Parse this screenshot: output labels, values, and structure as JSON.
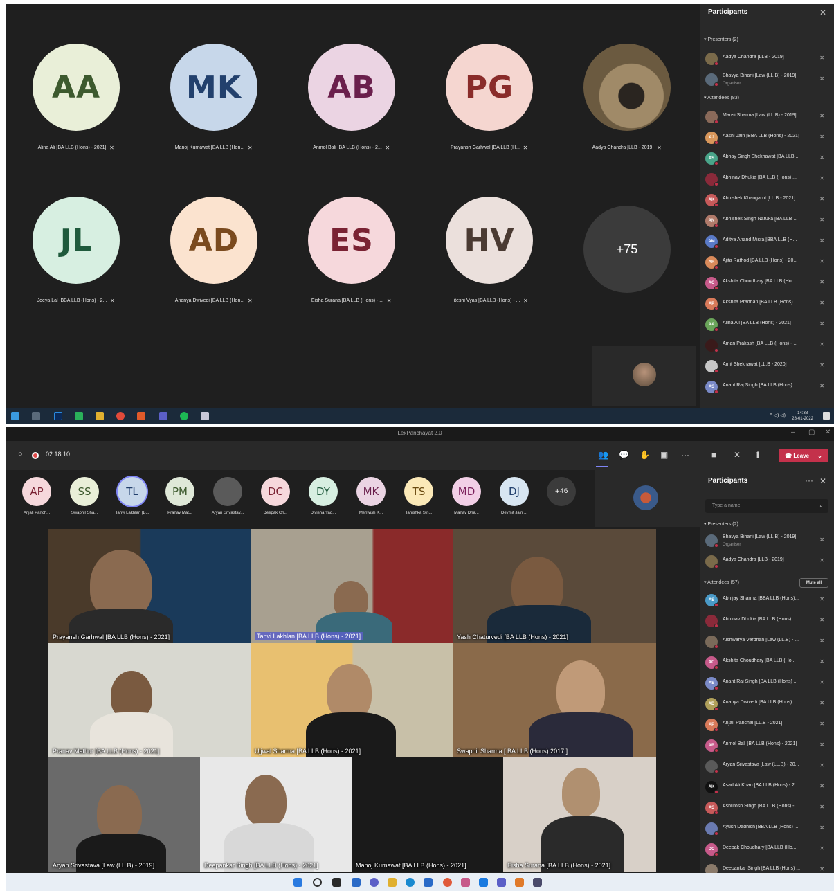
{
  "top": {
    "tiles_row1": [
      {
        "initials": "AA",
        "name": "Alina Ali [BA LLB (Hons) - 2021]",
        "bg": "#e9efd8",
        "fg": "#3d5a2e"
      },
      {
        "initials": "MK",
        "name": "Manoj Kumawat [BA LLB (Hon...",
        "bg": "#c7d7ea",
        "fg": "#22406d"
      },
      {
        "initials": "AB",
        "name": "Anmol Bali [BA LLB (Hons) - 2...",
        "bg": "#ebd4e3",
        "fg": "#6a1f4c"
      },
      {
        "initials": "PG",
        "name": "Prayansh Garhwal [BA LLB (H...",
        "bg": "#f5d6d0",
        "fg": "#8a2c2a"
      },
      {
        "initials": "",
        "name": "Aadya Chandra [LLB - 2019]",
        "bg": "#8a7a5a",
        "fg": "#fff"
      }
    ],
    "tiles_row2": [
      {
        "initials": "JL",
        "name": "Joeya Lal [BBA LLB (Hons) - 2...",
        "bg": "#d7efe1",
        "fg": "#1f5a3c"
      },
      {
        "initials": "AD",
        "name": "Ananya Dwivedi [BA LLB (Hon...",
        "bg": "#fbe3cf",
        "fg": "#7a4a1e"
      },
      {
        "initials": "ES",
        "name": "Eisha Surana [BA LLB (Hons) - ...",
        "bg": "#f6d8dc",
        "fg": "#7a2233"
      },
      {
        "initials": "HV",
        "name": "Hiteshi Vyas [BA LLB (Hons) - ...",
        "bg": "#ebe0dc",
        "fg": "#4a3a32"
      }
    ],
    "more_count": "+75",
    "panel": {
      "title": "Participants",
      "presenters_label": "Presenters (2)",
      "attendees_label": "Attendees (83)",
      "presenters": [
        {
          "name": "Aadya Chandra [LLB - 2019]",
          "sub": "",
          "initials": "",
          "color": "#7a6a4a"
        },
        {
          "name": "Bhavya Bihani [Law (LL.B) - 2019]",
          "sub": "Organiser",
          "initials": "",
          "color": "#5a6a7a"
        }
      ],
      "attendees": [
        {
          "name": "Mansi Sharma [Law (LL.B) - 2019]",
          "initials": "",
          "color": "#8a6a5a"
        },
        {
          "name": "Aashi Jain [BBA LLB (Hons) - 2021]",
          "initials": "AJ",
          "color": "#d9975b"
        },
        {
          "name": "Abhay Singh Shekhawat [BA LLB...",
          "initials": "AS",
          "color": "#4aa58a"
        },
        {
          "name": "Abhinav Dhukia [BA LLB (Hons) ...",
          "initials": "",
          "color": "#8a2a3a"
        },
        {
          "name": "Abhishek Khangarot [LL.B - 2021]",
          "initials": "AK",
          "color": "#c75a5a"
        },
        {
          "name": "Abhishek Singh Naruka [BA LLB ...",
          "initials": "AN",
          "color": "#b07a6a"
        },
        {
          "name": "Aditya Anand Misra [BBA LLB (H...",
          "initials": "AM",
          "color": "#5a7ac7"
        },
        {
          "name": "Ajita Rathod [BA LLB (Hons) - 20...",
          "initials": "AR",
          "color": "#d98a5a"
        },
        {
          "name": "Akshita Choudhary [BA LLB (Ho...",
          "initials": "AC",
          "color": "#c75a8a"
        },
        {
          "name": "Akshita Pradhan [BA LLB (Hons) ...",
          "initials": "AP",
          "color": "#d97a5a"
        },
        {
          "name": "Alina Ali [BA LLB (Hons) - 2021]",
          "initials": "AA",
          "color": "#6aa55a"
        },
        {
          "name": "Aman Prakash [BA LLB (Hons) - ...",
          "initials": "",
          "color": "#3a1a1a"
        },
        {
          "name": "Amit Shekhawat [LL.B - 2020]",
          "initials": "",
          "color": "#c7c7c7"
        },
        {
          "name": "Anant Raj Singh [BA LLB (Hons) ...",
          "initials": "AS",
          "color": "#7a8ac7"
        }
      ]
    },
    "taskbar_time": "14:38",
    "taskbar_date": "28-01-2022"
  },
  "bottom": {
    "window_title": "LexPanchayat 2.0",
    "timer": "02:18:10",
    "leave_label": "Leave",
    "strip": [
      {
        "initials": "AP",
        "name": "Anjali Panch...",
        "bg": "#f6d8dc",
        "fg": "#7a2233"
      },
      {
        "initials": "SS",
        "name": "Swapnil Sha...",
        "bg": "#e9efd8",
        "fg": "#3d5a2e"
      },
      {
        "initials": "TL",
        "name": "Tanvi Lakhlan [B...",
        "bg": "#c7d7ea",
        "fg": "#22406d"
      },
      {
        "initials": "PM",
        "name": "Pranav Mat...",
        "bg": "#dfe8d8",
        "fg": "#3d5a2e"
      },
      {
        "initials": "",
        "name": "Aryan Srivastav...",
        "bg": "#5a5a5a",
        "fg": "#fff"
      },
      {
        "initials": "DC",
        "name": "Deepak Ch...",
        "bg": "#f6d8dc",
        "fg": "#7a2233"
      },
      {
        "initials": "DY",
        "name": "Divisha Yad...",
        "bg": "#d7efe1",
        "fg": "#1f5a3c"
      },
      {
        "initials": "MK",
        "name": "Mehwish K...",
        "bg": "#ebd4e3",
        "fg": "#6a1f4c"
      },
      {
        "initials": "TS",
        "name": "Tanishka Sin...",
        "bg": "#fbe9b8",
        "fg": "#6a4a10"
      },
      {
        "initials": "MD",
        "name": "Manav Dha...",
        "bg": "#f2cfe6",
        "fg": "#7a1f5a"
      },
      {
        "initials": "DJ",
        "name": "Devmit Jain ...",
        "bg": "#d8e6f2",
        "fg": "#22406d"
      }
    ],
    "strip_more": "+46",
    "videos": [
      {
        "name": "Prayansh Garhwal [BA LLB (Hons) - 2021]",
        "highlight": false
      },
      {
        "name": "Tanvi Lakhlan [BA LLB (Hons) - 2021]",
        "highlight": true
      },
      {
        "name": "Yash Chaturvedi [BA LLB (Hons) - 2021]",
        "highlight": false
      },
      {
        "name": "Pranav Mathur [BA LLB (Hons) - 2021]",
        "highlight": false
      },
      {
        "name": "Ujjwal Sharma [BA LLB (Hons) - 2021]",
        "highlight": false
      },
      {
        "name": "Swapnil Sharma [ BA LLB (Hons) 2017 ]",
        "highlight": false
      },
      {
        "name": "Aryan Srivastava [Law (LL.B) - 2019]",
        "highlight": false
      },
      {
        "name": "Deepankar Singh [BA LLB (Hons) - 2021]",
        "highlight": false
      },
      {
        "name": "Manoj Kumawat [BA LLB (Hons) - 2021]",
        "highlight": false
      },
      {
        "name": "Eisha Surana [BA LLB (Hons) - 2021]",
        "highlight": false
      }
    ],
    "panel": {
      "title": "Participants",
      "search_placeholder": "Type a name",
      "presenters_label": "Presenters (2)",
      "attendees_label": "Attendees (57)",
      "mute_all": "Mute all",
      "presenters": [
        {
          "name": "Bhavya Bihani [Law (LL.B) - 2019]",
          "sub": "Organiser",
          "initials": "",
          "color": "#5a6a7a"
        },
        {
          "name": "Aadya Chandra [LLB - 2019]",
          "sub": "",
          "initials": "",
          "color": "#7a6a4a"
        }
      ],
      "attendees": [
        {
          "name": "Abhijay Sharma [BBA LLB (Hons)...",
          "initials": "AS",
          "color": "#4a9ac7"
        },
        {
          "name": "Abhinav Dhukia [BA LLB (Hons) ...",
          "initials": "",
          "color": "#8a2a3a"
        },
        {
          "name": "Aishwarya Verdhan [Law (LL.B) - ...",
          "initials": "",
          "color": "#7a6a5a"
        },
        {
          "name": "Akshita Choudhary [BA LLB (Ho...",
          "initials": "AC",
          "color": "#c75a8a"
        },
        {
          "name": "Anant Raj Singh [BA LLB (Hons) ...",
          "initials": "AS",
          "color": "#7a8ac7"
        },
        {
          "name": "Ananya Dwivedi [BA LLB (Hons) ...",
          "initials": "AD",
          "color": "#b0a05a"
        },
        {
          "name": "Anjali Panchal [LL.B - 2021]",
          "initials": "AP",
          "color": "#d97a5a"
        },
        {
          "name": "Anmol Bali [BA LLB (Hons) - 2021]",
          "initials": "AB",
          "color": "#c75a8a"
        },
        {
          "name": "Aryan Srivastava [Law (LL.B) - 20...",
          "initials": "",
          "color": "#5a5a5a"
        },
        {
          "name": "Asad Ali Khan [BA LLB (Hons) - 2...",
          "initials": "AK",
          "color": "#111111"
        },
        {
          "name": "Ashutosh Singh [BA LLB (Hons) -...",
          "initials": "AS",
          "color": "#c75a5a"
        },
        {
          "name": "Ayush Dadhich [BBA LLB (Hons) ...",
          "initials": "",
          "color": "#6a7ab0"
        },
        {
          "name": "Deepak Choudhary [BA LLB (Ho...",
          "initials": "DC",
          "color": "#c75a8a"
        },
        {
          "name": "Deepankar Singh [BA LLB (Hons) ...",
          "initials": "",
          "color": "#8a7a6a"
        }
      ]
    }
  }
}
